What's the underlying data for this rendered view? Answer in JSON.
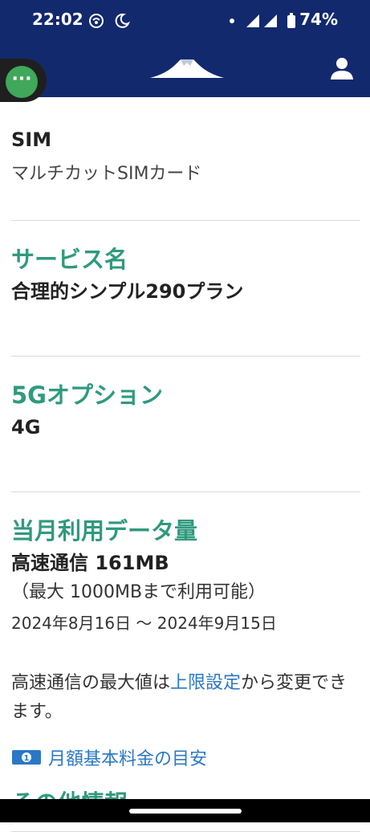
{
  "status": {
    "time": "22:02",
    "battery": "74%"
  },
  "sim": {
    "label": "SIM",
    "value": "マルチカットSIMカード"
  },
  "service": {
    "label": "サービス名",
    "value": "合理的シンプル290プラン"
  },
  "option5g": {
    "label": "5Gオプション",
    "value": "4G"
  },
  "data_usage": {
    "label": "当月利用データ量",
    "high_speed": "高速通信 161MB",
    "max": "（最大 1000MBまで利用可能）",
    "period": "2024年8月16日 〜 2024年9月15日",
    "note_prefix": "高速通信の最大値は",
    "note_link": "上限設定",
    "note_suffix": "から変更できます。",
    "fee_link": "月額基本料金の目安"
  },
  "other": {
    "label": "その他情報"
  },
  "colors": {
    "header": "#13296e",
    "accent": "#2f9a7e",
    "link": "#2a78c5",
    "chat": "#3fa85b"
  },
  "icons": [
    "chat-icon",
    "mount-fuji-logo",
    "account-icon",
    "yen-bill-icon"
  ]
}
